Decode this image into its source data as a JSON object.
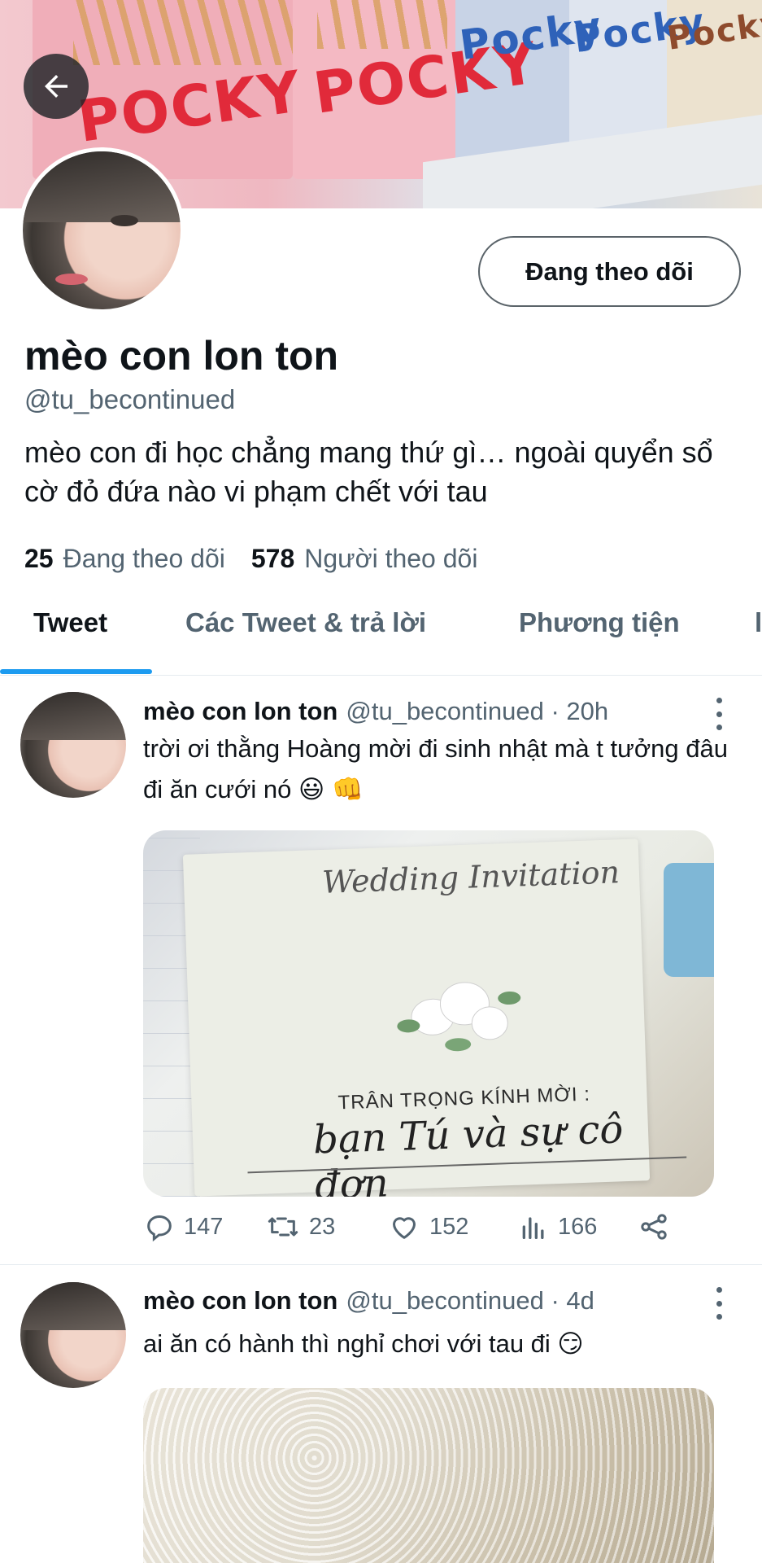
{
  "profile": {
    "name": "mèo con lon ton",
    "handle": "@tu_becontinued",
    "bio": "mèo con đi học chẳng mang thứ gì… ngoài quyển sổ cờ đỏ đứa nào vi phạm chết với tau",
    "following_count": "25",
    "following_label": "Đang theo dõi",
    "followers_count": "578",
    "followers_label": "Người theo dõi",
    "follow_button": "Đang theo dõi"
  },
  "banner": {
    "brand_text": "POCKY",
    "brand_text_short": "Pocky"
  },
  "tabs": [
    {
      "label": "Tweet",
      "active": true
    },
    {
      "label": "Các Tweet & trả lời",
      "active": false
    },
    {
      "label": "Phương tiện",
      "active": false
    },
    {
      "label": "l",
      "active": false
    }
  ],
  "tweets": [
    {
      "name": "mèo con lon ton",
      "handle": "@tu_becontinued",
      "time": "· 20h",
      "text": "trời ơi thằng Hoàng mời đi sinh nhật mà t tưởng đâu đi ăn cưới nó 😃 👊",
      "media": {
        "script_title": "Wedding Invitation",
        "line1": "TRÂN TRỌNG KÍNH MỜI :",
        "line2": "bạn Tú và sự cô đơn"
      },
      "replies": "147",
      "retweets": "23",
      "likes": "152",
      "views": "166"
    },
    {
      "name": "mèo con lon ton",
      "handle": "@tu_becontinued",
      "time": "· 4d",
      "text": "ai ăn có hành thì nghỉ chơi với tau đi 😏"
    }
  ],
  "icons": [
    "back-arrow-icon",
    "more-vertical-icon",
    "reply-icon",
    "retweet-icon",
    "like-icon",
    "views-icon",
    "share-icon"
  ],
  "colors": {
    "accent": "#1d9bf0",
    "text": "#0f1419",
    "muted": "#536471"
  }
}
